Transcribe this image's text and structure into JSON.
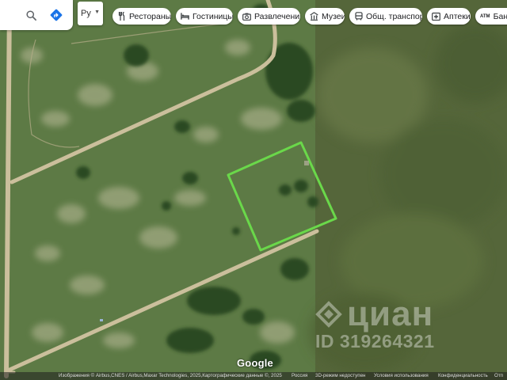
{
  "search": {
    "search_icon": "search-icon",
    "directions_icon": "directions-icon",
    "directions_color": "#1a73e8"
  },
  "language": {
    "value": "Ру"
  },
  "chips": [
    {
      "label": "Рестораны",
      "icon": "restaurant-icon"
    },
    {
      "label": "Гостиницы",
      "icon": "hotel-icon"
    },
    {
      "label": "Развлечения",
      "icon": "camera-icon"
    },
    {
      "label": "Музеи",
      "icon": "museum-icon"
    },
    {
      "label": "Общ. транспорт",
      "icon": "transit-icon"
    },
    {
      "label": "Аптеки",
      "icon": "pharmacy-icon"
    },
    {
      "label": "Банки",
      "icon": "atm-icon",
      "icon_text": "ATM"
    }
  ],
  "map": {
    "type": "satellite",
    "plot_outline_color": "#6ad84a"
  },
  "watermark": {
    "word": "циан",
    "listing_id": "ID 319264321"
  },
  "google_logo": "Google",
  "attribution": {
    "imagery": "Изображения © Airbus,CNES / Airbus,Maxar Technologies, 2025,Картографические данные ©, 2025",
    "country": "Россия",
    "mode_3d": "3D-режим недоступен",
    "terms": "Условия использования",
    "privacy": "Конфиденциальность",
    "feedback": "Отп"
  }
}
